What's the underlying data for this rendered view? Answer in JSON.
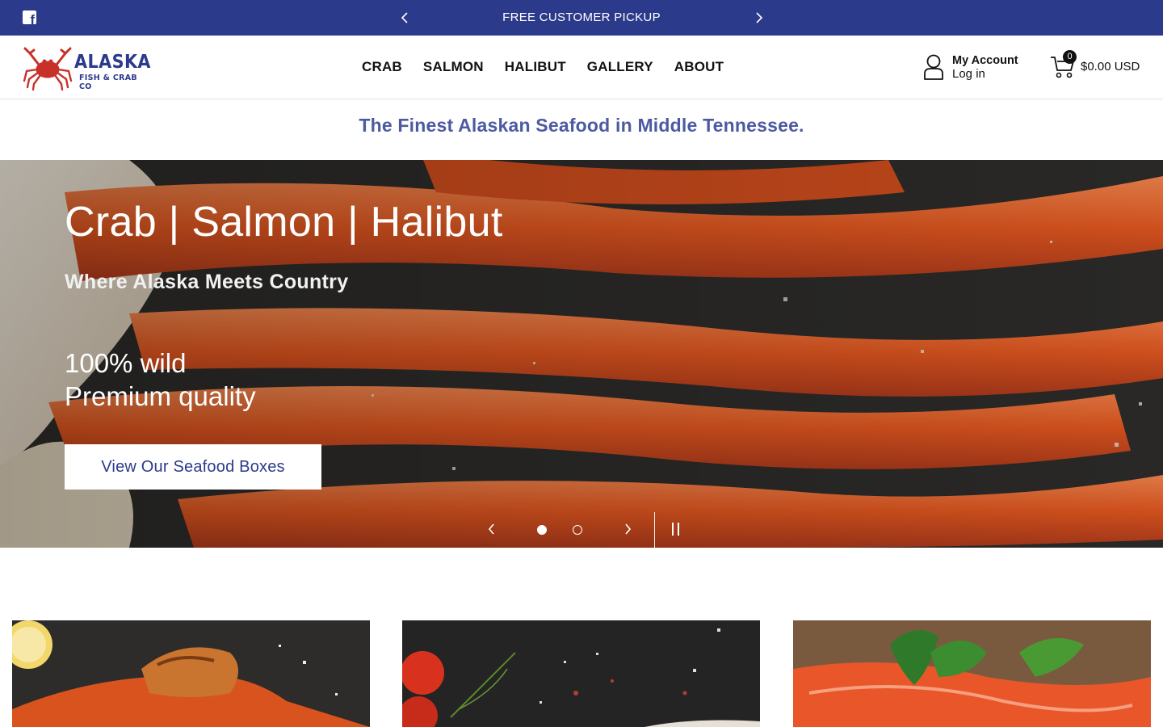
{
  "announcement": {
    "message": "FREE CUSTOMER PICKUP",
    "social": "facebook-icon"
  },
  "header": {
    "logo": {
      "line1": "ALASKA",
      "line2": "FISH & CRAB CO"
    },
    "nav": [
      "CRAB",
      "SALMON",
      "HALIBUT",
      "GALLERY",
      "ABOUT"
    ],
    "account": {
      "title": "My Account",
      "action": "Log in"
    },
    "cart": {
      "count": "0",
      "total": "$0.00 USD"
    }
  },
  "tagline": "The Finest Alaskan Seafood in Middle Tennessee.",
  "hero": {
    "title": "Crab | Salmon | Halibut",
    "subtitle": "Where Alaska Meets Country",
    "line1": "100% wild",
    "line2": "Premium quality",
    "cta": "View Our Seafood Boxes",
    "slides": 2,
    "active_slide": 1
  },
  "colors": {
    "brand": "#2c3a8c",
    "tagline": "#4c5aa1",
    "crab": "#d9531e"
  }
}
